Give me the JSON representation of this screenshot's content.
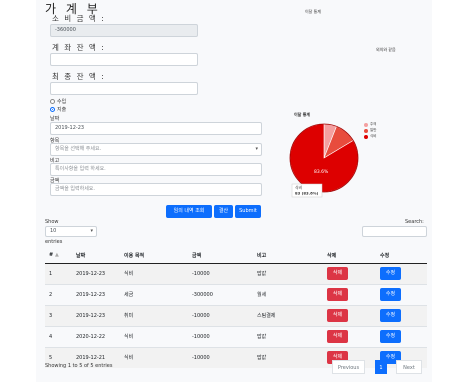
{
  "title": "가 계 부",
  "spent_label": "소 비 금 액 :",
  "spent_value": "-360000",
  "account_balance_label": "계 좌 잔 액 :",
  "final_balance_label": "최 종 잔 액 :",
  "radio": {
    "income": "수입",
    "expense": "지출"
  },
  "date_label": "날짜",
  "date_value": "2019-12-23",
  "category_label": "항목",
  "category_placeholder": "항목을 선택해 주세요.",
  "note_label": "비고",
  "note_placeholder": "특이사항을 입력 하세요.",
  "amount_label": "금액",
  "amount_placeholder": "금액을 입력하세요.",
  "buttons": {
    "view": "임의 내역 조회",
    "settle": "결산",
    "submit": "Submit"
  },
  "charts": {
    "top_title": "이달 통계",
    "top_subtitle": "외의와 같음",
    "pie_title": "이달 통계",
    "legend": [
      {
        "label": "주의",
        "color": "#f4a0a0"
      },
      {
        "label": "일반",
        "color": "#e84c3d"
      },
      {
        "label": "식비",
        "color": "#dd0000"
      }
    ],
    "pie_center_label": "83.6%",
    "tooltip_line1": "식비",
    "tooltip_line2": "83 (83.6%)"
  },
  "chart_data": {
    "type": "pie",
    "title": "이달 통계",
    "slices": [
      {
        "label": "식비",
        "value": 83.6,
        "color": "#dd0000"
      },
      {
        "label": "일반",
        "value": 10.4,
        "color": "#e84c3d"
      },
      {
        "label": "주의",
        "value": 6.0,
        "color": "#f4a0a0"
      }
    ]
  },
  "table_controls": {
    "show": "Show",
    "entries_value": "10",
    "entries": "entries",
    "search": "Search:"
  },
  "table": {
    "headers": [
      "#",
      "날짜",
      "이용 목적",
      "금액",
      "비고",
      "삭제",
      "수정"
    ],
    "rows": [
      {
        "num": "1",
        "date": "2019-12-23",
        "purpose": "식비",
        "amount": "-10000",
        "note": "밥값",
        "delete": "삭제",
        "edit": "수정"
      },
      {
        "num": "2",
        "date": "2019-12-23",
        "purpose": "세금",
        "amount": "-300000",
        "note": "월세",
        "delete": "삭제",
        "edit": "수정"
      },
      {
        "num": "3",
        "date": "2019-12-23",
        "purpose": "취미",
        "amount": "-10000",
        "note": "스팀결제",
        "delete": "삭제",
        "edit": "수정"
      },
      {
        "num": "4",
        "date": "2020-12-22",
        "purpose": "식비",
        "amount": "-10000",
        "note": "밥값",
        "delete": "삭제",
        "edit": "수정"
      },
      {
        "num": "5",
        "date": "2019-12-21",
        "purpose": "식비",
        "amount": "-10000",
        "note": "밥값",
        "delete": "삭제",
        "edit": "수정"
      }
    ]
  },
  "footer": {
    "info": "Showing 1 to 5 of 5 entries",
    "previous": "Previous",
    "page": "1",
    "next": "Next"
  }
}
